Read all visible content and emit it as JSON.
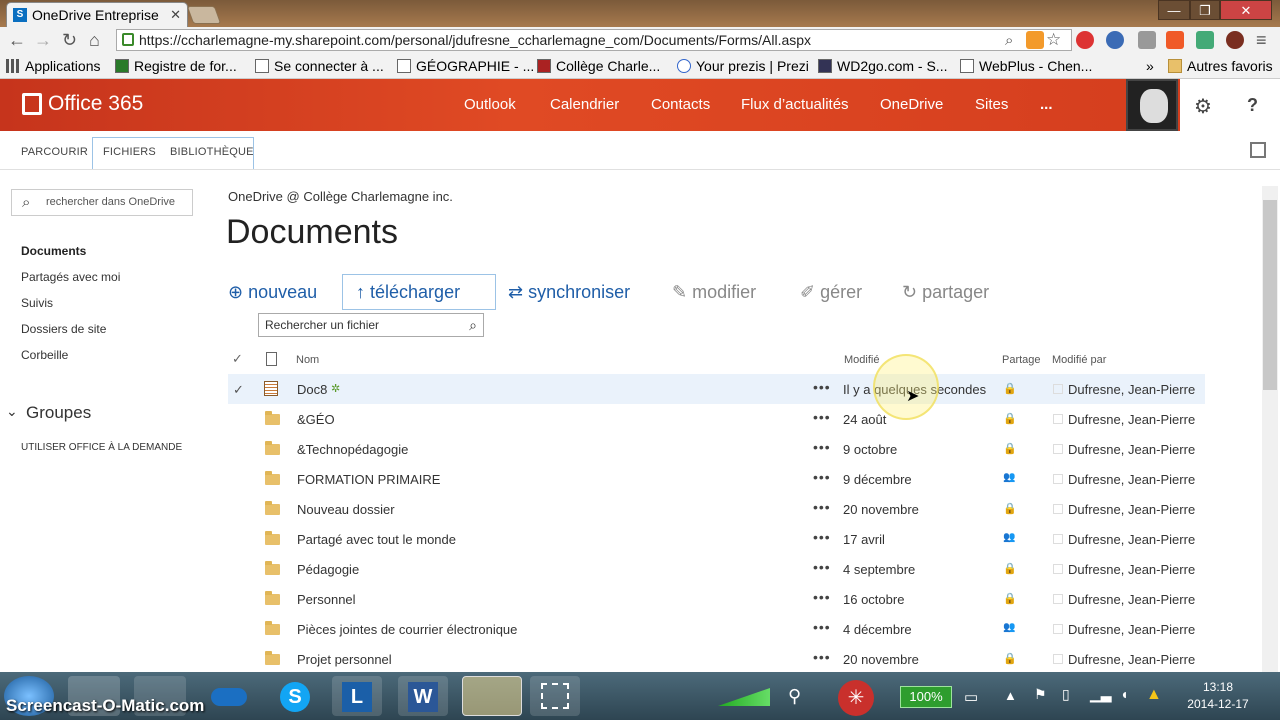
{
  "browser": {
    "tab_title": "OneDrive Entreprise",
    "tab_favicon": "S",
    "url": "https://ccharlemagne-my.sharepoint.com/personal/jdufresne_ccharlemagne_com/Documents/Forms/All.aspx",
    "bookmarks": [
      "Applications",
      "Registre de for...",
      "Se connecter à ...",
      "GÉOGRAPHIE - ...",
      "Collège Charle...",
      "Your prezis | Prezi",
      "WD2go.com - S...",
      "WebPlus - Chen..."
    ],
    "bookmarks_more": "»",
    "other_bookmarks": "Autres favoris"
  },
  "o365": {
    "logo": "Office 365",
    "nav": [
      "Outlook",
      "Calendrier",
      "Contacts",
      "Flux d’actualités",
      "OneDrive",
      "Sites",
      "..."
    ]
  },
  "ribbon": {
    "tabs": [
      "PARCOURIR",
      "FICHIERS",
      "BIBLIOTHÈQUE"
    ]
  },
  "left": {
    "search_placeholder": "rechercher dans OneDrive",
    "items": [
      "Documents",
      "Partagés avec moi",
      "Suivis",
      "Dossiers de site",
      "Corbeille"
    ],
    "groups_label": "Groupes",
    "office_demand": "UTILISER OFFICE À LA DEMANDE"
  },
  "main": {
    "breadcrumb": "OneDrive @ Collège Charlemagne inc.",
    "title": "Documents",
    "actions": [
      "nouveau",
      "télécharger",
      "synchroniser",
      "modifier",
      "gérer",
      "partager"
    ],
    "file_search_placeholder": "Rechercher un fichier",
    "columns": {
      "name": "Nom",
      "modified": "Modifié",
      "share": "Partage",
      "modified_by": "Modifié par"
    },
    "rows": [
      {
        "name": "Doc8",
        "modified": "Il y a quelques secondes",
        "by": "Dufresne, Jean-Pierre",
        "share": "lock",
        "type": "doc"
      },
      {
        "name": "&GÉO",
        "modified": "24 août",
        "by": "Dufresne, Jean-Pierre",
        "share": "lock",
        "type": "folder"
      },
      {
        "name": "&Technopédagogie",
        "modified": "9 octobre",
        "by": "Dufresne, Jean-Pierre",
        "share": "lock",
        "type": "folder"
      },
      {
        "name": "FORMATION PRIMAIRE",
        "modified": "9 décembre",
        "by": "Dufresne, Jean-Pierre",
        "share": "people",
        "type": "folder"
      },
      {
        "name": "Nouveau dossier",
        "modified": "20 novembre",
        "by": "Dufresne, Jean-Pierre",
        "share": "lock",
        "type": "folder"
      },
      {
        "name": "Partagé avec tout le monde",
        "modified": "17 avril",
        "by": "Dufresne, Jean-Pierre",
        "share": "people",
        "type": "folder"
      },
      {
        "name": "Pédagogie",
        "modified": "4 septembre",
        "by": "Dufresne, Jean-Pierre",
        "share": "lock",
        "type": "folder"
      },
      {
        "name": "Personnel",
        "modified": "16 octobre",
        "by": "Dufresne, Jean-Pierre",
        "share": "lock",
        "type": "folder"
      },
      {
        "name": "Pièces jointes de courrier électronique",
        "modified": "4 décembre",
        "by": "Dufresne, Jean-Pierre",
        "share": "people",
        "type": "folder"
      },
      {
        "name": "Projet personnel",
        "modified": "20 novembre",
        "by": "Dufresne, Jean-Pierre",
        "share": "lock",
        "type": "folder"
      }
    ]
  },
  "taskbar": {
    "watermark": "Screencast-O-Matic.com",
    "battery": "100%",
    "time": "13:18",
    "date": "2014-12-17"
  }
}
